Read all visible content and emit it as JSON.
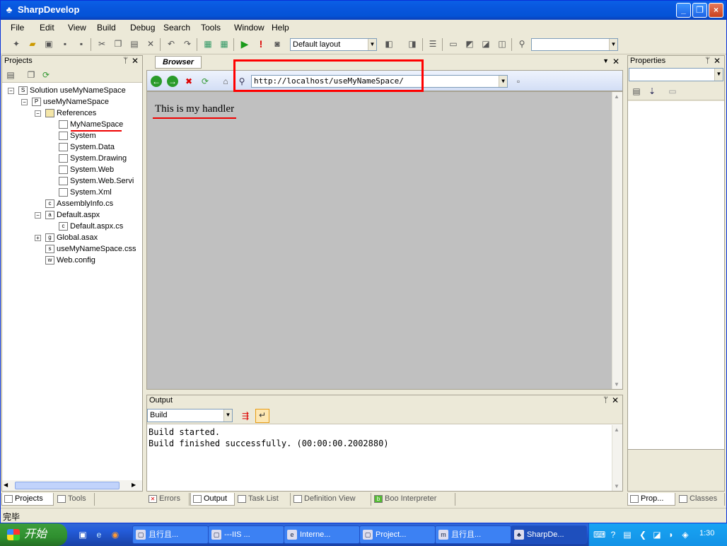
{
  "window": {
    "title": "SharpDevelop"
  },
  "menu": [
    "File",
    "Edit",
    "View",
    "Build",
    "Debug",
    "Search",
    "Tools",
    "Window",
    "Help"
  ],
  "toolbar": {
    "layout_value": "Default layout"
  },
  "projects": {
    "title": "Projects",
    "tree": [
      {
        "label": "Solution useMyNameSpace",
        "icon": "solution-icon"
      },
      {
        "label": "useMyNameSpace",
        "icon": "project-icon"
      },
      {
        "label": "References",
        "icon": "folder-icon"
      },
      {
        "label": "MyNameSpace",
        "icon": "reference-icon"
      },
      {
        "label": "System",
        "icon": "reference-icon"
      },
      {
        "label": "System.Data",
        "icon": "reference-icon"
      },
      {
        "label": "System.Drawing",
        "icon": "reference-icon"
      },
      {
        "label": "System.Web",
        "icon": "reference-icon"
      },
      {
        "label": "System.Web.Servi",
        "icon": "reference-icon"
      },
      {
        "label": "System.Xml",
        "icon": "reference-icon"
      },
      {
        "label": "AssemblyInfo.cs",
        "icon": "cs-file-icon"
      },
      {
        "label": "Default.aspx",
        "icon": "aspx-file-icon"
      },
      {
        "label": "Default.aspx.cs",
        "icon": "cs-file-icon"
      },
      {
        "label": "Global.asax",
        "icon": "asax-file-icon"
      },
      {
        "label": "useMyNameSpace.css",
        "icon": "css-file-icon"
      },
      {
        "label": "Web.config",
        "icon": "config-file-icon"
      }
    ],
    "bottom_tabs": [
      "Projects",
      "Tools"
    ]
  },
  "browser": {
    "tab": "Browser",
    "url": "http://localhost/useMyNameSpace/",
    "content": "This is my handler"
  },
  "output": {
    "title": "Output",
    "source": "Build",
    "lines": [
      "Build started.",
      "Build finished successfully. (00:00:00.2002880)"
    ],
    "bottom_tabs": [
      "Errors",
      "Output",
      "Task List",
      "Definition View",
      "Boo Interpreter"
    ]
  },
  "properties": {
    "title": "Properties",
    "bottom_tabs": [
      "Prop...",
      "Classes"
    ]
  },
  "status": {
    "text": "完毕"
  },
  "taskbar": {
    "start": "开始",
    "tasks": [
      "且行且...",
      "---IIS ...",
      "Interne...",
      "Project...",
      "且行且...",
      "SharpDe..."
    ],
    "clock": "1:30"
  },
  "colors": {
    "title_blue": "#0a5fe6",
    "annotation_red": "#ff0000",
    "browser_bg": "#c0c0c0"
  }
}
